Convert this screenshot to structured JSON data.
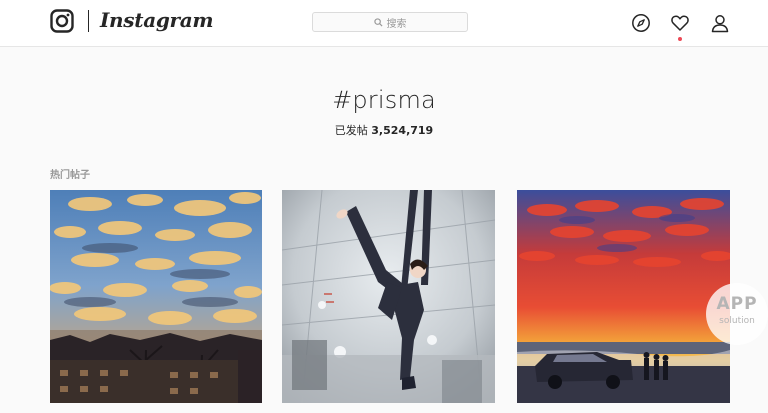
{
  "header": {
    "brand": "Instagram",
    "search_placeholder": "搜索",
    "icons": [
      "instagram-logo-icon",
      "search-icon",
      "compass-icon",
      "heart-icon",
      "profile-icon"
    ],
    "notification_color": "#ed4956"
  },
  "tag": {
    "title": "#prisma",
    "posts_label": "已发帖",
    "posts_count": "3,524,719"
  },
  "top_posts": {
    "heading": "热门帖子",
    "photos": [
      {
        "subject": "sunset-clouds-over-houses"
      },
      {
        "subject": "aerial-silk-dancer"
      },
      {
        "subject": "red-sky-over-beach"
      }
    ]
  },
  "watermark": {
    "line1": "APP",
    "line2": "solution"
  }
}
